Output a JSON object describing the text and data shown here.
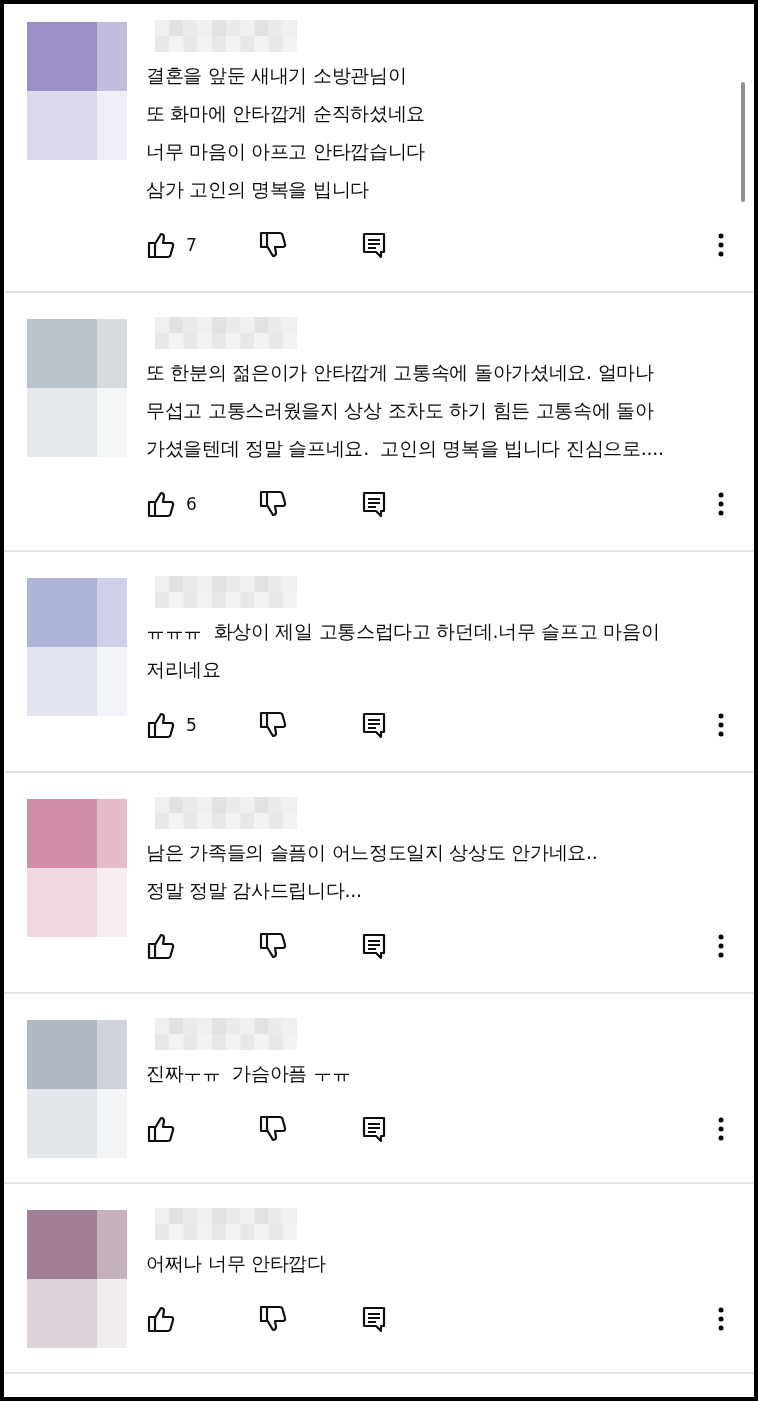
{
  "comments": [
    {
      "color": "#9b8fc6",
      "lines": [
        "결혼을 앞둔 새내기 소방관님이",
        "또 화마에 안타깝게 순직하셨네요",
        "너무 마음이 아프고 안타깝습니다",
        "삼가 고인의 명복을 빕니다"
      ],
      "likes": "7"
    },
    {
      "color": "#b9c3c9",
      "lines": [
        "또 한분의 젊은이가 안타깝게 고통속에 돌아가셨네요. 얼마나",
        "무섭고 고통스러웠을지 상상 조차도 하기 힘든 고통속에 돌아",
        "가셨을텐데 정말 슬프네요.  고인의 명복을 빕니다 진심으로...."
      ],
      "likes": "6"
    },
    {
      "color": "#aeb3d8",
      "lines": [
        "ㅠㅠㅠ  화상이 제일 고통스럽다고 하던데.너무 슬프고 마음이",
        "저리네요"
      ],
      "likes": "5"
    },
    {
      "color": "#d28ea8",
      "lines": [
        "남은 가족들의 슬픔이 어느정도일지 상상도 안가네요..",
        "정말 정말 감사드립니다..."
      ]
    },
    {
      "color": "#b0b8c2",
      "lines": [
        "진짜ㅜㅠ  가슴아픔 ㅜㅠ"
      ]
    },
    {
      "color": "#a07e94",
      "lines": [
        "어쩌나 너무 안타깝다"
      ]
    }
  ]
}
